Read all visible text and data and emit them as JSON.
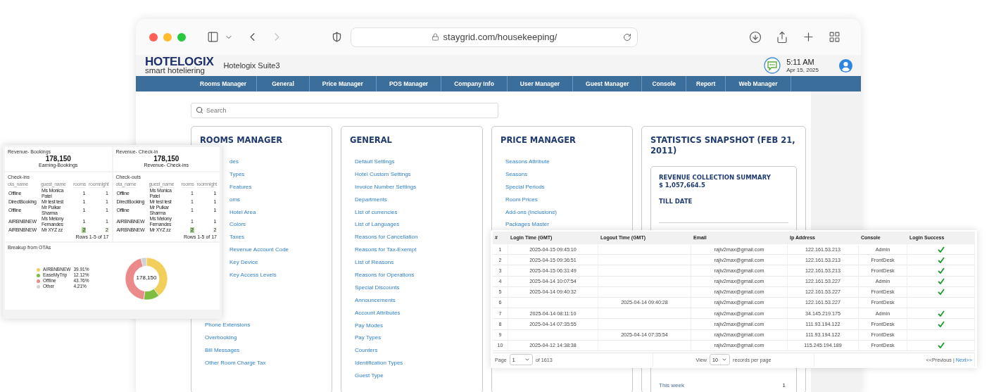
{
  "browser": {
    "url": "staygrid.com/housekeeping/",
    "forward_disabled": true
  },
  "app_header": {
    "logo_title": "HOTELOGIX",
    "logo_tagline": "smart hoteliering",
    "suite": "Hotelogix Suite3",
    "time": "5:11 AM",
    "date": "Apr 15, 2025"
  },
  "nav": [
    "Rooms Manager",
    "General",
    "Price Manager",
    "POS Manager",
    "Company Info",
    "User Manager",
    "Guest Manager",
    "Console",
    "Report",
    "Web Manager"
  ],
  "search": {
    "placeholder": "Search"
  },
  "panels": [
    {
      "title": "ROOMS MANAGER",
      "cut_items": [
        "des",
        "Types",
        "Features",
        "oms",
        "Hotel Area",
        "Colors",
        "Taxes",
        "Revenue Account Code",
        "Key Device",
        "Key Access Levels"
      ],
      "items": [
        "Phone Extensions",
        "Overbooking",
        "Bill Messages",
        "Other Room Charge Tax"
      ]
    },
    {
      "title": "GENERAL",
      "items": [
        "Default Settings",
        "Hotel Custom Settings",
        "Invoice Number Settings",
        "Departments",
        "List of currencies",
        "List of Languages",
        "Reasons for Cancellation",
        "Reasons for Tax-Exempt",
        "List of Reasons",
        "Reasons for Operations",
        "Special Discounts",
        "Announcements",
        "Account Attributes",
        "Pay Modes",
        "Pay Types",
        "Counters",
        "Identification Types",
        "Guest Type"
      ]
    },
    {
      "title": "PRICE MANAGER",
      "items": [
        "Seasons Attribute",
        "Seasons",
        "Special Periods",
        "Room Prices",
        "Add-ons (Inclusions)",
        "Packages Master"
      ]
    }
  ],
  "statistics": {
    "title": "STATISTICS SNAPSHOT (FEB 21, 2011)",
    "summary_title": "REVENUE COLLECTION SUMMARY",
    "summary_amount": "$ 1,057,664.5",
    "till_date": "TILL DATE",
    "row_label": "This week",
    "row_value": "1"
  },
  "dashboard": {
    "kpis": [
      {
        "caption_top": "Revenue- Bookings",
        "value": "178,150",
        "caption": "Earning-Bookings"
      },
      {
        "caption_top": "Revenue- Check-in",
        "value": "178,150",
        "caption": "Revenue- Check-ins"
      }
    ],
    "tables": [
      {
        "title": "Check-ins",
        "columns": [
          "ota_name",
          "guest_name",
          "rooms",
          "roomnight"
        ],
        "rows": [
          {
            "cells": [
              "Offline",
              "Ms Monica Patel",
              "1",
              "1"
            ],
            "highlighted": false
          },
          {
            "cells": [
              "DirectBooking",
              "Mr test test",
              "1",
              "1"
            ],
            "highlighted": false
          },
          {
            "cells": [
              "Offline",
              "Mr Pulkar Sharma",
              "1",
              "1"
            ],
            "highlighted": false
          },
          {
            "cells": [
              "AIRBNBNEW",
              "Ms Melony Fernandes",
              "1",
              "1"
            ],
            "highlighted": false
          },
          {
            "cells": [
              "AIRBNBNEW",
              "Mr XYZ zz",
              "2",
              "2"
            ],
            "highlighted": true
          }
        ],
        "pager": "Rows 1-5 of 17"
      },
      {
        "title": "Check-outs",
        "columns": [
          "ota_name",
          "guest_name",
          "rooms",
          "roomnight"
        ],
        "rows": [
          {
            "cells": [
              "Offline",
              "Ms Monica Patel",
              "1",
              "1"
            ],
            "highlighted": false
          },
          {
            "cells": [
              "DirectBooking",
              "Mr test test",
              "1",
              "1"
            ],
            "highlighted": false
          },
          {
            "cells": [
              "Offline",
              "Mr Pulkar Sharma",
              "1",
              "1"
            ],
            "highlighted": false
          },
          {
            "cells": [
              "AIRBNBNEW",
              "Ms Melony Fernandes",
              "1",
              "1"
            ],
            "highlighted": false
          },
          {
            "cells": [
              "AIRBNBNEW",
              "Mr XYZ zz",
              "2",
              "2"
            ],
            "highlighted": true
          }
        ],
        "pager": "Rows 1-5 of 17"
      }
    ],
    "ota": {
      "title": "Breakup from OTAs",
      "legend": [
        {
          "value": "39.91%",
          "color": "#f2cf5b"
        },
        {
          "value": "12.12%",
          "color": "#7dbd42"
        },
        {
          "value": "43.76%",
          "color": "#ea8a8a"
        },
        {
          "value": "4.21%",
          "color": "#cfd2d6"
        }
      ],
      "center_label": "178,150",
      "chart_data": {
        "type": "donut",
        "categories": [
          "AIRBNBNEW",
          "EaseMyTrip",
          "Offline",
          "Other"
        ],
        "values": [
          39.91,
          12.12,
          43.76,
          4.21
        ]
      }
    }
  },
  "login_table": {
    "columns": [
      "#",
      "Login Time (GMT)",
      "Logout Time (GMT)",
      "Email",
      "Ip Address",
      "Console",
      "Login Success"
    ],
    "rows": [
      {
        "n": "1",
        "login": "2025-04-15 09:45:10",
        "email": "rajiv2max@gmail.com",
        "ip": "122.161.53.213",
        "console": "Admin",
        "success": true
      },
      {
        "n": "2",
        "login": "2025-04-15 09:36:51",
        "email": "rajiv2max@gmail.com",
        "ip": "122.161.53.213",
        "console": "FrontDesk",
        "success": true
      },
      {
        "n": "3",
        "login": "2025-04-15 06:31:49",
        "email": "rajiv2max@gmail.com",
        "ip": "122.161.53.213",
        "console": "FrontDesk",
        "success": true
      },
      {
        "n": "4",
        "login": "2025-04-14 10:07:54",
        "email": "rajiv2max@gmail.com",
        "ip": "122.161.53.227",
        "console": "Admin",
        "success": true
      },
      {
        "n": "5",
        "login": "2025-04-14 09:40:32",
        "email": "rajiv2max@gmail.com",
        "ip": "122.161.53.227",
        "console": "FrontDesk",
        "success": true
      },
      {
        "n": "6",
        "logout": "2025-04-14 09:40:28",
        "email": "rajiv2max@gmail.com",
        "ip": "122.161.53.227",
        "console": "FrontDesk",
        "success": false
      },
      {
        "n": "7",
        "login": "2025-04-14 08:11:10",
        "email": "rajiv2max@gmail.com",
        "ip": "34.145.219.175",
        "console": "Admin",
        "success": true
      },
      {
        "n": "8",
        "login": "2025-04-14 07:35:55",
        "email": "rajiv2max@gmail.com",
        "ip": "111.93.194.122",
        "console": "FrontDesk",
        "success": true
      },
      {
        "n": "9",
        "logout": "2025-04-14 07:35:54",
        "email": "rajiv2max@gmail.com",
        "ip": "111.93.194.122",
        "console": "FrontDesk",
        "success": false
      },
      {
        "n": "10",
        "login": "2025-04-12 14:38:38",
        "email": "rajiv2max@gmail.com",
        "ip": "115.245.194.189",
        "console": "FrontDesk",
        "success": true
      }
    ],
    "footer": {
      "page_label": "Page",
      "page_value": "1",
      "page_total": "of 1613",
      "view_label": "View",
      "view_value": "10",
      "view_suffix": "records per page",
      "previous": "<<Previous |",
      "next": "Next>>"
    }
  }
}
